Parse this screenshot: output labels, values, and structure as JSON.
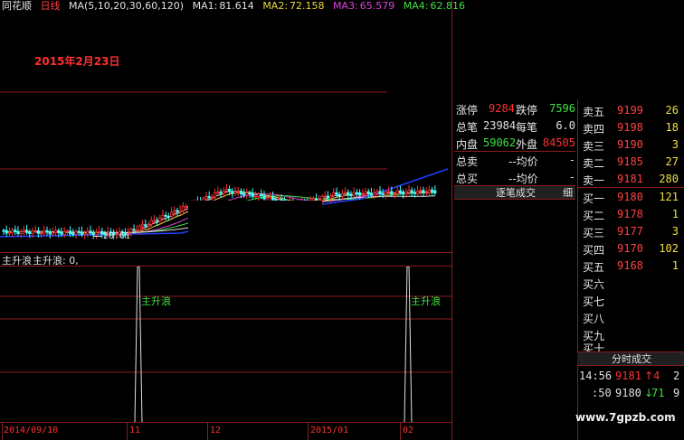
{
  "topbar": {
    "app_name": "同花顺",
    "period": "日线",
    "ma_params": "MA(5,10,20,30,60,120)",
    "ma1_label": "MA1:",
    "ma1_value": "81.614",
    "ma2_label": "MA2:",
    "ma2_value": "72.158",
    "ma3_label": "MA3:",
    "ma3_value": "65.579",
    "ma4_label": "MA4:",
    "ma4_value": "62.816"
  },
  "chart": {
    "date_annotation": "2015年2月23日",
    "low_price_label": "20.61",
    "indicator_title": "主升浪",
    "indicator_readout": "主升浪: 0,",
    "signal_label_1": "主升浪",
    "signal_label_2": "主升浪",
    "x_labels": [
      "2014/09/10",
      "11",
      "12",
      "2015/01",
      "02"
    ]
  },
  "stats": {
    "limit_up_label": "涨停",
    "limit_up_value": "9284",
    "limit_down_label": "跌停",
    "limit_down_value": "7596",
    "total_trades_label": "总笔",
    "total_trades_value": "23984",
    "per_trade_label": "每笔",
    "per_trade_value": "6.0",
    "inner_label": "内盘",
    "inner_value": "59062",
    "outer_label": "外盘",
    "outer_value": "84505",
    "total_sell_label": "总卖",
    "total_sell_avg": "--均价",
    "total_sell_dash": "-",
    "total_buy_label": "总买",
    "total_buy_avg": "--均价",
    "total_buy_dash": "-",
    "tick_trades_tab": "逐笔成交",
    "tick_trades_tab2": "细"
  },
  "orderbook": {
    "asks": [
      {
        "label": "卖五",
        "price": "9199",
        "vol": "26"
      },
      {
        "label": "卖四",
        "price": "9198",
        "vol": "18"
      },
      {
        "label": "卖三",
        "price": "9190",
        "vol": "3"
      },
      {
        "label": "卖二",
        "price": "9185",
        "vol": "27"
      },
      {
        "label": "卖一",
        "price": "9181",
        "vol": "280"
      }
    ],
    "bids": [
      {
        "label": "买一",
        "price": "9180",
        "vol": "121"
      },
      {
        "label": "买二",
        "price": "9178",
        "vol": "1"
      },
      {
        "label": "买三",
        "price": "9177",
        "vol": "3"
      },
      {
        "label": "买四",
        "price": "9170",
        "vol": "102"
      },
      {
        "label": "买五",
        "price": "9168",
        "vol": "1"
      },
      {
        "label": "买六",
        "price": "",
        "vol": ""
      },
      {
        "label": "买七",
        "price": "",
        "vol": ""
      },
      {
        "label": "买八",
        "price": "",
        "vol": ""
      },
      {
        "label": "买九",
        "price": "",
        "vol": ""
      },
      {
        "label": "买十",
        "price": "",
        "vol": ""
      }
    ],
    "time_trades_tab": "分时成交",
    "ticks": [
      {
        "time": "14:56",
        "price": "9181",
        "dir": "↑",
        "vol": "4",
        "n": "2"
      },
      {
        "time": ":50",
        "price": "9180",
        "dir": "↓",
        "vol": "71",
        "n": "9"
      }
    ]
  },
  "watermark": "www.7gpzb.com",
  "colors": {
    "up": "#ff3030",
    "down": "#40ffff",
    "grid": "#8b1c1c",
    "ma_white": "#e0e0e0",
    "ma_yellow": "#e8d840",
    "ma_magenta": "#e040e0",
    "ma_green": "#40e040",
    "ma_blue": "#2040ff",
    "signal_green": "#40e040"
  }
}
